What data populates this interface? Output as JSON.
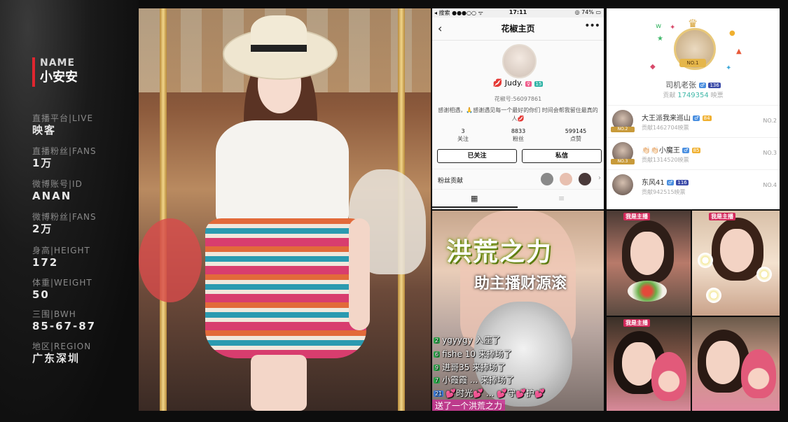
{
  "profile_card": {
    "name_label": "NAME",
    "name_value": "小安安",
    "fields": [
      {
        "label": "直播平台|LIVE",
        "value": "映客"
      },
      {
        "label": "直播粉丝|FANS",
        "value": "1万"
      },
      {
        "label": "微博账号|ID",
        "value": "ANAN"
      },
      {
        "label": "微博粉丝|FANS",
        "value": "2万"
      },
      {
        "label": "身高|HEIGHT",
        "value": "172"
      },
      {
        "label": "体重|WEIGHT",
        "value": "50"
      },
      {
        "label": "三围|BWH",
        "value": "85-67-87"
      },
      {
        "label": "地区|REGION",
        "value": "广东深圳"
      }
    ],
    "accent_color": "#e0262f"
  },
  "app_profile": {
    "status_left": "◂ 搜索 ●●●○○ ᯤ",
    "status_time": "17:11",
    "status_right": "◎ 74% ▭",
    "title": "花椒主页",
    "back_icon": "‹",
    "more_icon": "•••",
    "user_name": "Judy.",
    "gender_badge": "♀",
    "level_badge": "15",
    "user_id": "花椒号:56097861",
    "bio": "感谢相遇，🙏感谢遇见每一个最好的你们 时间会帮我留住最真的人💋",
    "stats": [
      {
        "num": "3",
        "label": "关注"
      },
      {
        "num": "8833",
        "label": "粉丝"
      },
      {
        "num": "599145",
        "label": "点赞"
      }
    ],
    "follow_button": "已关注",
    "message_button": "私信",
    "fans_contrib_label": "粉丝贡献",
    "chevron_icon": "›",
    "grid_icon": "▦",
    "list_icon": "≡"
  },
  "ranking": {
    "crown_icon": "♛",
    "no1_tag": "NO.1",
    "top_user": {
      "name": "司机老张",
      "badge": "♂",
      "level": "136",
      "contrib_prefix": "贡献",
      "contrib_value": "1749354",
      "contrib_suffix": "映票"
    },
    "rows": [
      {
        "name": "大王派我来巡山",
        "badge": "♂",
        "level": "84",
        "contrib": "贡献1462704映票",
        "rank": "NO.2",
        "tag": "NO.2"
      },
      {
        "name": "👏🏻👏🏻小魔王",
        "badge": "♂",
        "level": "85",
        "contrib": "贡献1314520映票",
        "rank": "NO.3",
        "tag": "NO.3"
      },
      {
        "name": "东风41",
        "badge": "♂",
        "level": "116",
        "contrib": "贡献942515映票",
        "rank": "NO.4",
        "tag": ""
      }
    ]
  },
  "live_stream": {
    "title": "洪荒之力",
    "subtitle": "助主播财源滚",
    "chat": [
      {
        "level": "2",
        "text": "ygyygy 入座了",
        "color": "#2aa84a"
      },
      {
        "level": "6",
        "text": "fishe 10 来捧场了",
        "color": "#2aa84a"
      },
      {
        "level": "9",
        "text": "进哥35 来捧场了",
        "color": "#2aa84a"
      },
      {
        "level": "7",
        "text": "小霞霞 ... 来捧场了",
        "color": "#2aa84a"
      },
      {
        "level": "21",
        "text": "💕时光💕 ... 💕守💕护💕",
        "color": "#3a7ad8"
      }
    ],
    "gift_text": "送了一个洪荒之力"
  },
  "screenshots": {
    "live_tag": "我是主播"
  }
}
